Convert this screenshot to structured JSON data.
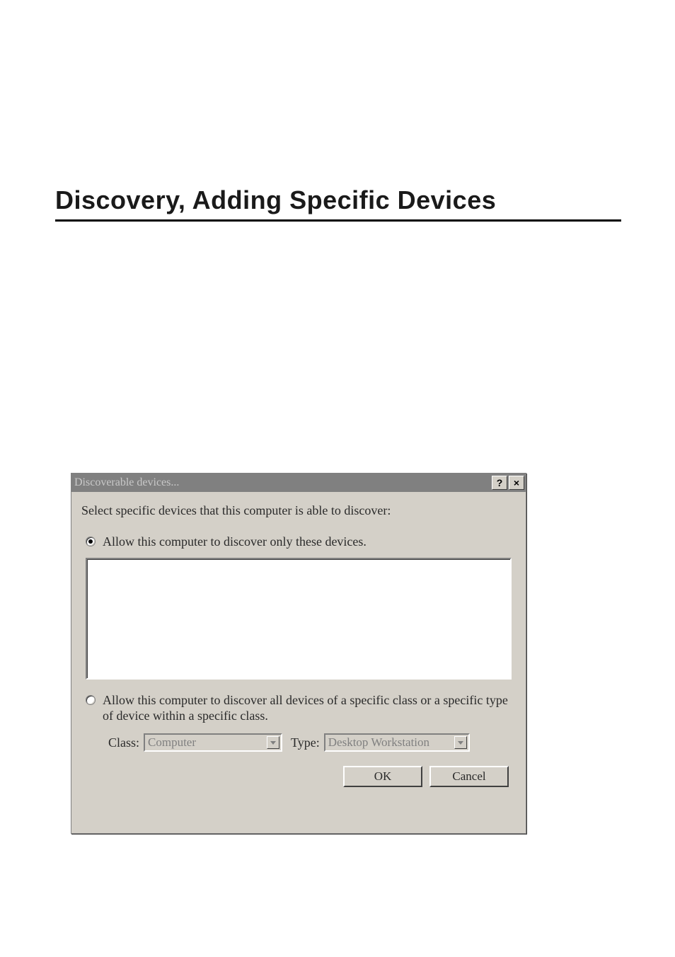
{
  "heading": "Discovery, Adding Specific Devices",
  "dialog": {
    "title": "Discoverable devices...",
    "help_icon": "?",
    "close_icon": "×",
    "instruction": "Select specific devices that this computer is able to discover:",
    "radio1_label": "Allow this computer to discover only these devices.",
    "radio2_label": "Allow this computer to discover all devices of a specific class or a specific type of device within a specific class.",
    "class_label": "Class:",
    "class_value": "Computer",
    "type_label": "Type:",
    "type_value": "Desktop Workstation",
    "ok_label": "OK",
    "cancel_label": "Cancel"
  }
}
